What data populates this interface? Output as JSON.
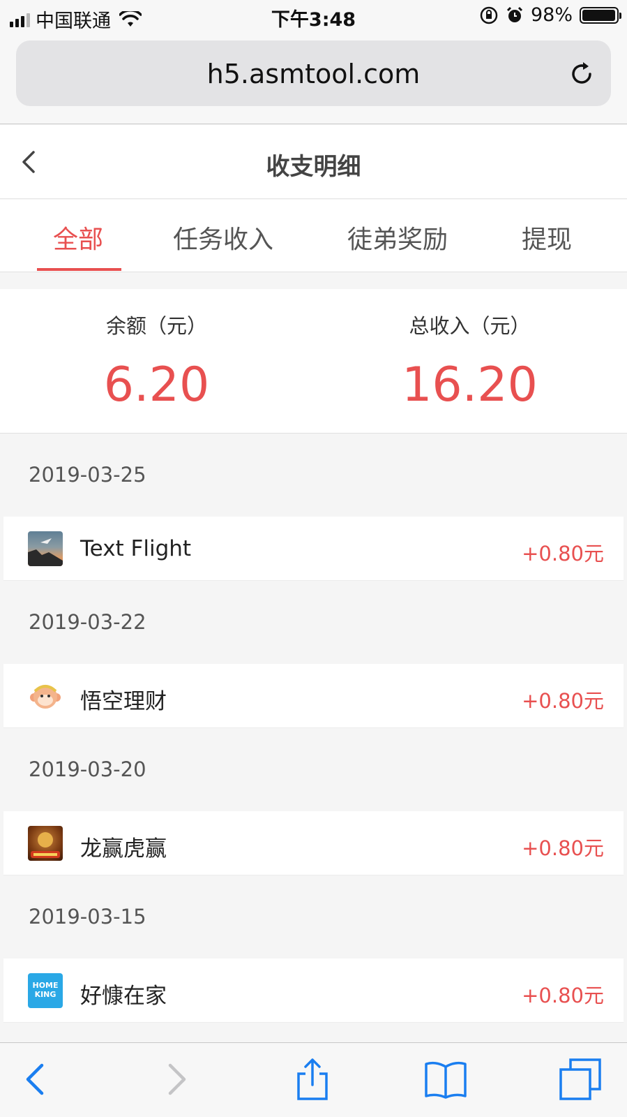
{
  "status_bar": {
    "carrier": "中国联通",
    "time": "下午3:48",
    "battery": "98%",
    "battery_level": 0.98
  },
  "browser": {
    "url": "h5.asmtool.com"
  },
  "header": {
    "title": "收支明细"
  },
  "tabs": [
    {
      "label": "全部",
      "active": true
    },
    {
      "label": "任务收入",
      "active": false
    },
    {
      "label": "徒弟奖励",
      "active": false
    },
    {
      "label": "提现",
      "active": false
    }
  ],
  "summary": {
    "balance_label": "余额（元）",
    "balance_value": "6.20",
    "income_label": "总收入（元）",
    "income_value": "16.20"
  },
  "records": [
    {
      "date": "2019-03-25",
      "name": "Text Flight",
      "amount": "+0.80元",
      "icon": "text-flight-app-icon"
    },
    {
      "date": "2019-03-22",
      "name": "悟空理财",
      "amount": "+0.80元",
      "icon": "wukong-licai-app-icon"
    },
    {
      "date": "2019-03-20",
      "name": "龙赢虎赢",
      "amount": "+0.80元",
      "icon": "longying-huying-app-icon"
    },
    {
      "date": "2019-03-15",
      "name": "好慷在家",
      "amount": "+0.80元",
      "icon": "homeking-app-icon",
      "icon_text": [
        "HOME",
        "KING"
      ]
    }
  ],
  "colors": {
    "accent": "#e85050",
    "ios_blue": "#1a7ef0",
    "background": "#f5f5f5"
  }
}
